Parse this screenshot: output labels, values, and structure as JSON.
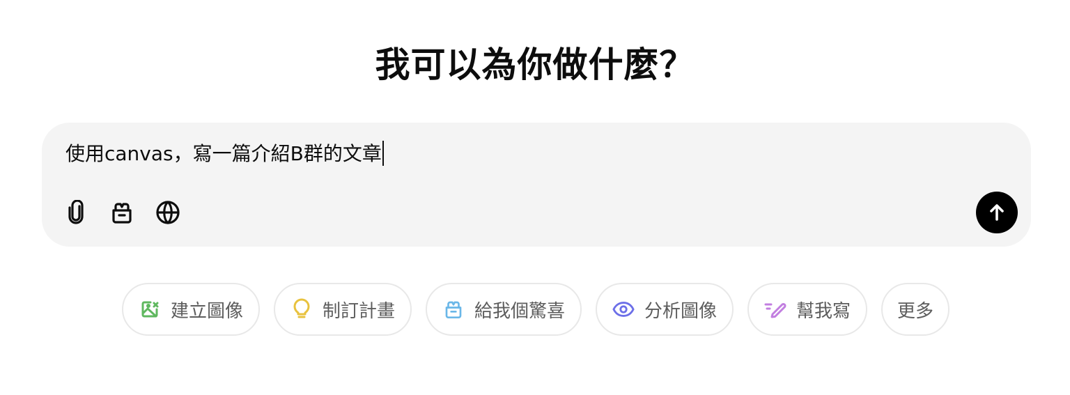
{
  "heading": "我可以為你做什麼？",
  "composer": {
    "input_value": "使用canvas，寫一篇介紹B群的文章",
    "tools": [
      {
        "icon": "paperclip-icon"
      },
      {
        "icon": "toolbox-icon"
      },
      {
        "icon": "globe-icon"
      }
    ],
    "send_icon": "arrow-up-icon"
  },
  "suggestions": [
    {
      "label": "建立圖像",
      "icon": "image-create-icon",
      "color": "#5fb85f"
    },
    {
      "label": "制訂計畫",
      "icon": "lightbulb-icon",
      "color": "#e8c23e"
    },
    {
      "label": "給我個驚喜",
      "icon": "gift-box-icon",
      "color": "#6ab7e8"
    },
    {
      "label": "分析圖像",
      "icon": "eye-icon",
      "color": "#6c6fe8"
    },
    {
      "label": "幫我寫",
      "icon": "pen-icon",
      "color": "#c27ee0"
    },
    {
      "label": "更多"
    }
  ]
}
